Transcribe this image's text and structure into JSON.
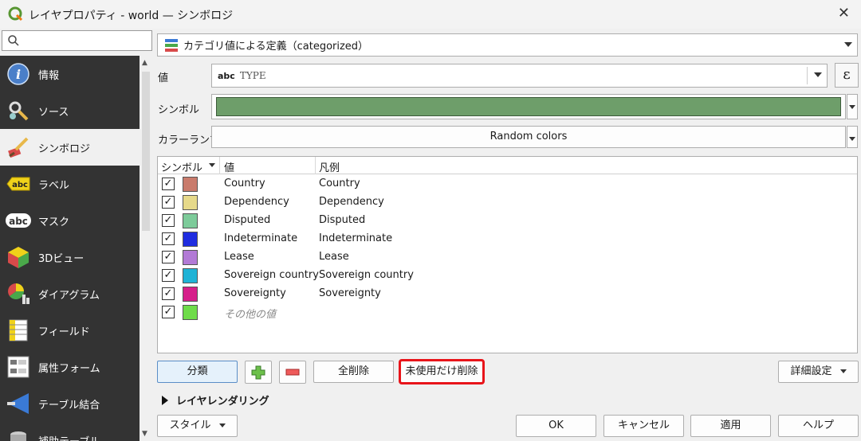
{
  "window": {
    "title": "レイヤプロパティ - world — シンボロジ"
  },
  "sidebar": {
    "search_placeholder": "",
    "items": [
      {
        "label": "情報",
        "icon": "info-icon"
      },
      {
        "label": "ソース",
        "icon": "source-icon"
      },
      {
        "label": "シンボロジ",
        "icon": "symbology-icon",
        "active": true
      },
      {
        "label": "ラベル",
        "icon": "labels-icon"
      },
      {
        "label": "マスク",
        "icon": "mask-icon"
      },
      {
        "label": "3Dビュー",
        "icon": "3d-view-icon"
      },
      {
        "label": "ダイアグラム",
        "icon": "diagram-icon"
      },
      {
        "label": "フィールド",
        "icon": "fields-icon"
      },
      {
        "label": "属性フォーム",
        "icon": "attribute-form-icon"
      },
      {
        "label": "テーブル結合",
        "icon": "join-icon"
      },
      {
        "label": "補助テーブル",
        "icon": "auxiliary-table-icon"
      }
    ]
  },
  "renderer": {
    "label": "カテゴリ値による定義（categorized）"
  },
  "value_row": {
    "label": "値",
    "type_badge": "abc",
    "value": "TYPE",
    "expression_button": "ε"
  },
  "symbol_row": {
    "label": "シンボル",
    "color": "#6e9e6a"
  },
  "ramp_row": {
    "label": "カラーランプ",
    "value": "Random colors"
  },
  "table": {
    "headers": {
      "symbol": "シンボル",
      "value": "値",
      "legend": "凡例"
    },
    "rows": [
      {
        "value": "Country",
        "legend": "Country",
        "color": "#c97b6c",
        "checked": true
      },
      {
        "value": "Dependency",
        "legend": "Dependency",
        "color": "#e6d98a",
        "checked": true
      },
      {
        "value": "Disputed",
        "legend": "Disputed",
        "color": "#7dcb9a",
        "checked": true
      },
      {
        "value": "Indeterminate",
        "legend": "Indeterminate",
        "color": "#1f2de0",
        "checked": true
      },
      {
        "value": "Lease",
        "legend": "Lease",
        "color": "#b27ad6",
        "checked": true
      },
      {
        "value": "Sovereign country",
        "legend": "Sovereign country",
        "color": "#1fb3d6",
        "checked": true
      },
      {
        "value": "Sovereignty",
        "legend": "Sovereignty",
        "color": "#d61f8a",
        "checked": true
      },
      {
        "value": "その他の値",
        "legend": "",
        "color": "#6fdc4a",
        "checked": true,
        "other": true
      }
    ]
  },
  "buttons": {
    "classify": "分類",
    "delete_all": "全削除",
    "delete_unused": "未使用だけ削除",
    "advanced": "詳細設定",
    "style": "スタイル",
    "ok": "OK",
    "cancel": "キャンセル",
    "apply": "適用",
    "help": "ヘルプ"
  },
  "layer_rendering": {
    "label": "レイヤレンダリング"
  }
}
